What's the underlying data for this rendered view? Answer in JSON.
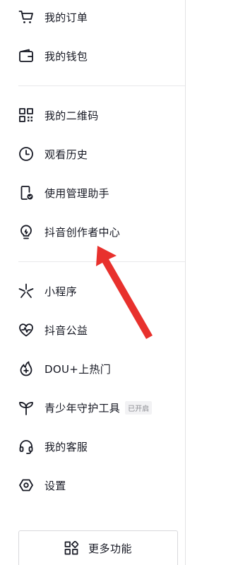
{
  "menu": {
    "orders": "我的订单",
    "wallet": "我的钱包",
    "qrcode": "我的二维码",
    "history": "观看历史",
    "usage_manager": "使用管理助手",
    "creator_center": "抖音创作者中心",
    "mini_program": "小程序",
    "charity": "抖音公益",
    "dou_plus": "DOU+上热门",
    "youth_mode": "青少年守护工具",
    "youth_mode_badge": "已开启",
    "customer_service": "我的客服",
    "settings": "设置"
  },
  "more_button": "更多功能",
  "colors": {
    "text": "#161823",
    "annotation_arrow": "#e8312d",
    "badge_bg": "#f2f2f4",
    "badge_text": "#8a8b91",
    "divider": "#e8e8ea"
  }
}
